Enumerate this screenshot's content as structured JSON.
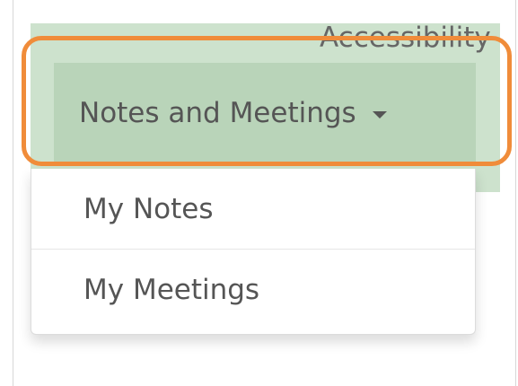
{
  "navbar": {
    "top_link_label": "Accessibility",
    "dropdown_toggle_label": "Notes and Meetings",
    "dropdown_caret_icon": "caret-down-icon"
  },
  "dropdown": {
    "items": [
      {
        "label": "My Notes"
      },
      {
        "label": "My Meetings"
      }
    ]
  },
  "colors": {
    "navbar_bg": "#cde2cd",
    "toggle_bg": "#b9d4b9",
    "highlight": "#f08c3a",
    "text": "#555555"
  }
}
